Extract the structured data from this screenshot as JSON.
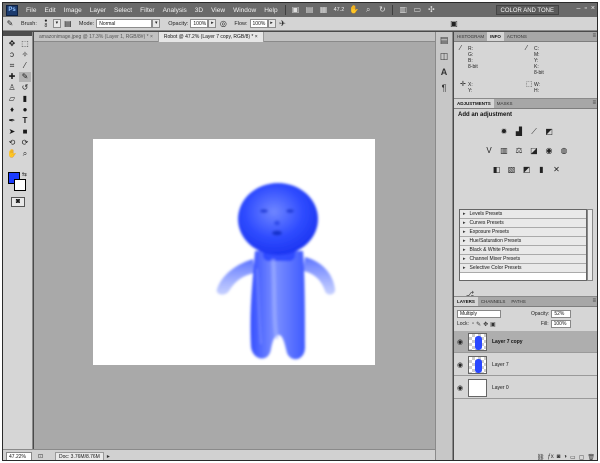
{
  "app": {
    "logo": "Ps"
  },
  "menu": [
    "File",
    "Edit",
    "Image",
    "Layer",
    "Select",
    "Filter",
    "Analysis",
    "3D",
    "View",
    "Window",
    "Help"
  ],
  "menubar": {
    "zoom": "47.2",
    "workspace": "COLOR AND TONE",
    "icons": [
      "bridge-icon",
      "minibridge-icon",
      "hand-icon",
      "zoom-icon",
      "rotate-icon",
      "grid-icon",
      "arrange-icon",
      "screen-mode-icon"
    ]
  },
  "options": {
    "brush_label": "Brush:",
    "brush_size": "8",
    "mode_label": "Mode:",
    "mode_value": "Normal",
    "opacity_label": "Opacity:",
    "opacity_value": "100%",
    "flow_label": "Flow:",
    "flow_value": "100%"
  },
  "tools": [
    "move",
    "marquee",
    "lasso",
    "quick-select",
    "crop",
    "eyedropper",
    "spot-heal",
    "brush",
    "clone-stamp",
    "history-brush",
    "eraser",
    "gradient",
    "blur",
    "dodge",
    "pen",
    "type",
    "path-select",
    "shape",
    "3d-rotate",
    "3d-camera",
    "hand",
    "zoom"
  ],
  "document": {
    "tabs": [
      {
        "label": "amazonimage.jpeg @ 17.3% (Layer 1, RGB/8#) *",
        "active": false
      },
      {
        "label": "Robot @ 47.2% (Layer 7 copy, RGB/8) *",
        "active": true
      }
    ],
    "close_glyph": "×"
  },
  "status": {
    "zoom": "47.22%",
    "doc": "Doc: 3.76M/8.76M"
  },
  "panels": {
    "info": {
      "tabs": [
        "HISTOGRAM",
        "INFO",
        "ACTIONS"
      ],
      "active_tab": "INFO",
      "left_top": [
        "R:",
        "G:",
        "B:",
        "8-bit"
      ],
      "right_top": [
        "C:",
        "M:",
        "Y:",
        "K:",
        "8-bit"
      ],
      "left_bottom": [
        "X:",
        "Y:"
      ],
      "right_bottom": [
        "W:",
        "H:"
      ]
    },
    "adjustments": {
      "tabs": [
        "ADJUSTMENTS",
        "MASKS"
      ],
      "active_tab": "ADJUSTMENTS",
      "title": "Add an adjustment",
      "presets": [
        "Levels Presets",
        "Curves Presets",
        "Exposure Presets",
        "Hue/Saturation Presets",
        "Black & White Presets",
        "Channel Mixer Presets",
        "Selective Color Presets"
      ]
    },
    "layers": {
      "tabs": [
        "LAYERS",
        "CHANNELS",
        "PATHS"
      ],
      "active_tab": "LAYERS",
      "blend_mode": "Multiply",
      "opacity_label": "Opacity:",
      "opacity_value": "52%",
      "lock_label": "Lock:",
      "fill_label": "Fill:",
      "fill_value": "100%",
      "items": [
        {
          "name": "Layer 7 copy",
          "selected": true,
          "thumb": "robot"
        },
        {
          "name": "Layer 7",
          "selected": false,
          "thumb": "robot"
        },
        {
          "name": "Layer 0",
          "selected": false,
          "thumb": "white"
        }
      ]
    }
  },
  "colors": {
    "foreground": "#1b3cff",
    "background": "#ffffff",
    "robot_blue": "#2a48ff"
  }
}
